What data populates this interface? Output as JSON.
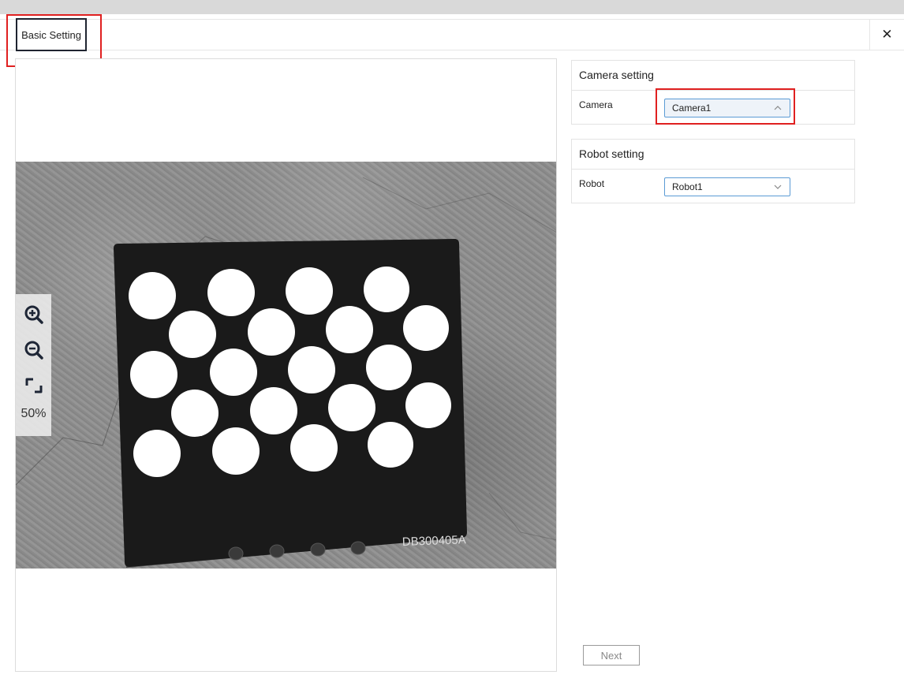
{
  "header": {
    "tabs": [
      {
        "label": "Basic Setting",
        "active": true
      }
    ],
    "close_icon": "close-icon"
  },
  "viewer": {
    "image_label": "DB300405A",
    "zoom_level": "50%",
    "tools": [
      "zoom-in-icon",
      "zoom-out-icon",
      "fit-screen-icon"
    ]
  },
  "camera_setting": {
    "title": "Camera setting",
    "field_label": "Camera",
    "selected": "Camera1",
    "open": true
  },
  "robot_setting": {
    "title": "Robot setting",
    "field_label": "Robot",
    "selected": "Robot1",
    "open": false
  },
  "footer": {
    "next_label": "Next"
  },
  "colors": {
    "highlight": "#e02020",
    "select_border": "#5b9bd5",
    "board": "#1a1a1a"
  }
}
